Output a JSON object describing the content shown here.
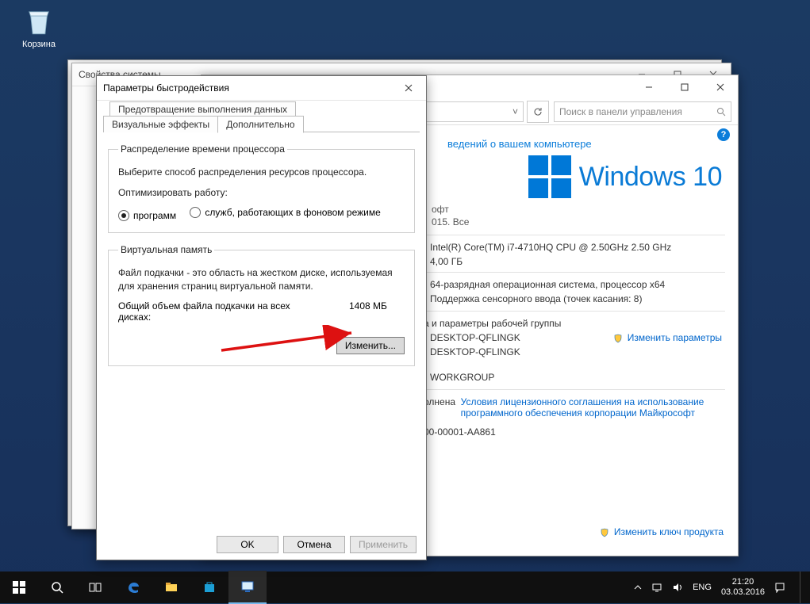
{
  "desktop": {
    "recycle_label": "Корзина"
  },
  "sys_window": {
    "title": "Свойства системы"
  },
  "cp_window": {
    "search_placeholder": "Поиск в панели управления",
    "heading": "ведений о вашем компьютере",
    "brand": "Windows 10",
    "copyright_partial": "офт\n015. Все",
    "processor": "Intel(R) Core(TM) i7-4710HQ CPU @ 2.50GHz   2.50 GHz",
    "ram": "4,00 ГБ",
    "system_type": "64-разрядная операционная система, процессор x64",
    "pen_touch": "Поддержка сенсорного ввода (точек касания: 8)",
    "group_heading": "а и параметры рабочей группы",
    "computer_name": "DESKTOP-QFLINGK",
    "full_name": "DESKTOP-QFLINGK",
    "workgroup": "WORKGROUP",
    "change_settings": "Изменить параметры",
    "activation_partial": "олнена",
    "license_link": "Условия лицензионного соглашения на использование программного обеспечения корпорации Майкрософт",
    "product_id_partial": "00-00001-AA861",
    "change_key": "Изменить ключ продукта"
  },
  "perf_window": {
    "title": "Параметры быстродействия",
    "tab_prevention": "Предотвращение выполнения данных",
    "tab_visual": "Визуальные эффекты",
    "tab_advanced": "Дополнительно",
    "cpu_group": "Распределение времени процессора",
    "cpu_hint": "Выберите способ распределения ресурсов процессора.",
    "optimize_label": "Оптимизировать работу:",
    "radio_programs": "программ",
    "radio_services": "служб, работающих в фоновом режиме",
    "vm_group": "Виртуальная память",
    "vm_hint": "Файл подкачки - это область на жестком диске, используемая для хранения страниц виртуальной памяти.",
    "vm_total_label": "Общий объем файла подкачки на всех дисках:",
    "vm_total_value": "1408 МБ",
    "change_btn": "Изменить...",
    "ok": "OK",
    "cancel": "Отмена",
    "apply": "Применить"
  },
  "taskbar": {
    "lang": "ENG",
    "time": "21:20",
    "date": "03.03.2016"
  }
}
